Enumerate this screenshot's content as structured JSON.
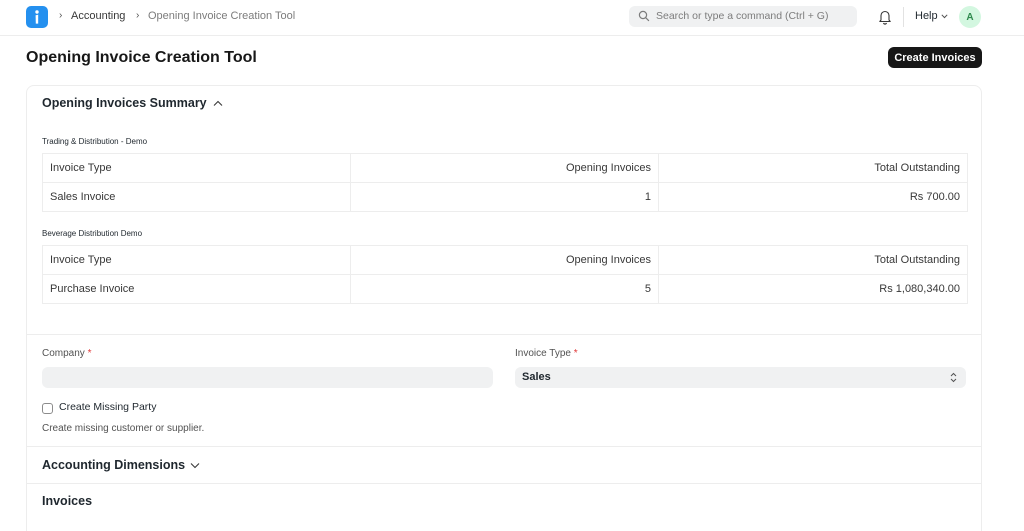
{
  "navbar": {
    "breadcrumbs": [
      "Accounting",
      "Opening Invoice Creation Tool"
    ],
    "search_placeholder": "Search or type a command (Ctrl + G)",
    "help_label": "Help",
    "avatar_initial": "A"
  },
  "page": {
    "title": "Opening Invoice Creation Tool",
    "primary_action": "Create Invoices"
  },
  "summary": {
    "heading": "Opening Invoices Summary",
    "companies": [
      {
        "name": "Trading & Distribution - Demo",
        "headers": [
          "Invoice Type",
          "Opening Invoices",
          "Total Outstanding"
        ],
        "row": [
          "Sales Invoice",
          "1",
          "Rs 700.00"
        ]
      },
      {
        "name": "Beverage Distribution Demo",
        "headers": [
          "Invoice Type",
          "Opening Invoices",
          "Total Outstanding"
        ],
        "row": [
          "Purchase Invoice",
          "5",
          "Rs 1,080,340.00"
        ]
      }
    ]
  },
  "form": {
    "company_label": "Company",
    "company_value": "",
    "invoice_type_label": "Invoice Type",
    "invoice_type_value": "Sales",
    "required_mark": "*",
    "create_missing_party_label": "Create Missing Party",
    "create_missing_party_checked": false,
    "create_missing_party_help": "Create missing customer or supplier."
  },
  "sections": {
    "accounting_dimensions": "Accounting Dimensions",
    "invoices": "Invoices"
  },
  "colors": {
    "brand": "#2490ef",
    "primary_button": "#171717",
    "required": "#e03636"
  }
}
